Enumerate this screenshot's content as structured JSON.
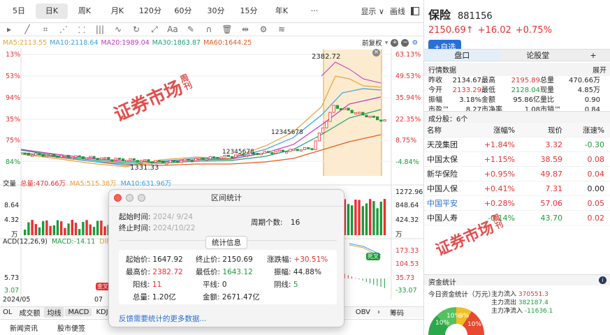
{
  "tabs": {
    "items": [
      "5日",
      "日K",
      "周K",
      "月K",
      "120分",
      "60分",
      "30分",
      "15分",
      "年K",
      "···"
    ]
  },
  "topbar": {
    "display": "显示 ∨",
    "draw": "画线"
  },
  "ma": {
    "ma5": "MA5:2113.55",
    "ma10": "MA10:2118.64",
    "ma20": "MA20:1989.04",
    "ma30": "MA30:1863.87",
    "ma60": "MA60:1644.25",
    "fuquan": "前复权"
  },
  "left_axis": {
    "ticks": [
      "13%",
      "53%",
      "94%",
      "35%",
      "75%",
      "84%"
    ]
  },
  "right_axis": {
    "ticks": [
      "63.13%",
      "49.53%",
      "35.94%",
      "22.35%",
      "8.75%",
      "-4.84%"
    ]
  },
  "price": {
    "high_label": "2382.72",
    "low_label": "1331.33",
    "seq_top": "3",
    "seq_mid": "12345678",
    "seq_mid2": "12345678"
  },
  "volume": {
    "label": "总量",
    "total": "总量:470.66万",
    "ma5": "MA5:515.38万",
    "ma10": "MA10:631.96万",
    "ticks_l": [
      "交量",
      "8.64",
      "4.32",
      "万"
    ],
    "ticks_r": [
      "1272.96",
      "848.64",
      "424.32",
      "万"
    ]
  },
  "macd": {
    "label": "ACD(12,26,9)",
    "macd": "MACD:-14.11",
    "diff": "DIFF:13",
    "ticks_l": [
      "",
      "",
      "5.73",
      "3.07"
    ],
    "ticks_r": [
      "173.33",
      "104.53",
      "35.73",
      "-33.07"
    ],
    "tag1": "死叉",
    "tag2": "金叉"
  },
  "dates": {
    "d1": "2024/05",
    "d2": "07"
  },
  "bottom_tabs": {
    "items": [
      "OL",
      "成交额",
      "均线",
      "MACD",
      "KDJ"
    ],
    "obv": "OBV",
    "more": "筹码"
  },
  "bottom_tabs2": {
    "items": [
      "新闻资讯",
      "股市便签"
    ]
  },
  "stamp": {
    "text": "证券市场",
    "sub": "周刊"
  },
  "dialog": {
    "title": "区间统计",
    "start_label": "起始时间:",
    "start_val": "2024/ 9/24",
    "end_label": "终止时间:",
    "end_val": "2024/10/22",
    "period_label": "周期个数:",
    "period_val": "16",
    "info_btn": "统计信息",
    "open_label": "起始价:",
    "open_val": "1647.92",
    "close_label": "终止价:",
    "close_val": "2150.69",
    "chg_label": "涨跌幅:",
    "chg_val": "+30.51%",
    "hi_label": "最高价:",
    "hi_val": "2382.72",
    "lo_label": "最低价:",
    "lo_val": "1643.12",
    "amp_label": "振幅:",
    "amp_val": "44.88%",
    "up_label": "阳线:",
    "up_val": "11",
    "flat_label": "平线:",
    "flat_val": "0",
    "down_label": "阴线:",
    "down_val": "5",
    "vol_label": "总量:",
    "vol_val": "1.20亿",
    "amt_label": "金额:",
    "amt_val": "2671.47亿",
    "feedback": "反馈需要统计的更多数据..."
  },
  "stock": {
    "name": "保险",
    "code": "881156",
    "price": "2150.69↑",
    "chg": "+16.02",
    "pct": "+0.75%",
    "add": "+自选"
  },
  "rtabs": {
    "panel": "盘口",
    "forum": "论股堂",
    "plus": "+"
  },
  "quote": {
    "title": "行情数据",
    "expand": "展开",
    "rows": [
      [
        "昨收",
        "2134.67",
        "最高",
        "2195.89",
        "总量",
        "470.66万"
      ],
      [
        "今开",
        "2133.29",
        "最低",
        "2128.04",
        "现量",
        "4.85万"
      ],
      [
        "振幅",
        "3.18%",
        "金额",
        "95.86亿",
        "量比",
        "0.90"
      ],
      [
        "市盈™",
        "8.27",
        "市净率",
        "1.08",
        "市销™",
        "0.84"
      ]
    ]
  },
  "components": {
    "title": "成分股：6个",
    "headers": [
      "名称",
      "涨幅%",
      "现价",
      "涨速%"
    ],
    "rows": [
      [
        "天茂集团",
        "+1.84%",
        "3.32",
        "-0.30"
      ],
      [
        "中国太保",
        "+1.15%",
        "38.59",
        "0.08"
      ],
      [
        "新华保险",
        "+0.95%",
        "49.87",
        "0.04"
      ],
      [
        "中国人保",
        "+0.41%",
        "7.31",
        "0.00"
      ],
      [
        "中国平安",
        "+0.28%",
        "57.06",
        "0.05"
      ],
      [
        "中国人寿",
        "-0.14%",
        "43.70",
        "0.02"
      ]
    ]
  },
  "fund": {
    "title": "资金统计",
    "label": "今日资金统计（万元）:",
    "in_label": "主力流入",
    "in_val": "370551.3",
    "out_label": "主力流出",
    "out_val": "382187.4",
    "net_label": "主力净流入",
    "net_val": "-11636.1",
    "pie": [
      "10%",
      "9%",
      "10%",
      "10%"
    ]
  },
  "colors": {
    "up": "#e83030",
    "down": "#1f9a3a",
    "ma5": "#e8a23a",
    "ma10": "#3aa0e8",
    "ma20": "#c038c0",
    "ma30": "#20a070",
    "ma60": "#e85a1a",
    "highlight": "#fce7c6"
  }
}
